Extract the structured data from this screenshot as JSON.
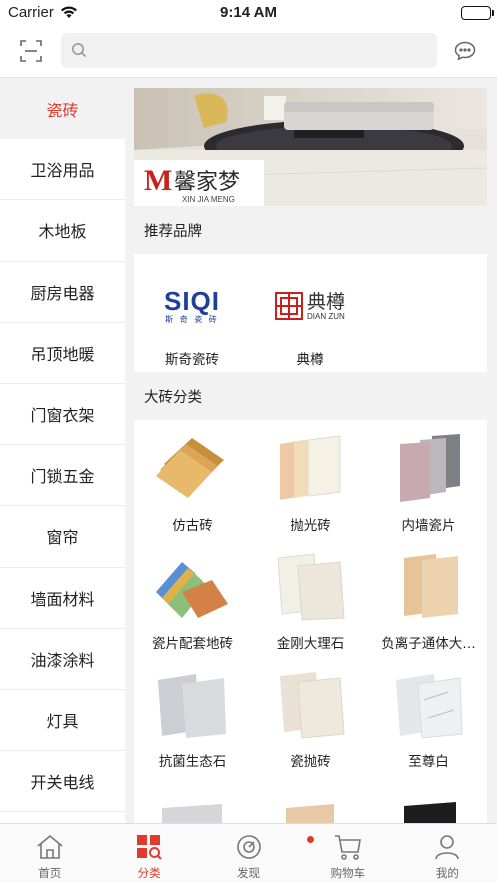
{
  "status_bar": {
    "carrier": "Carrier",
    "time": "9:14 AM"
  },
  "search": {
    "placeholder": ""
  },
  "sidebar": {
    "items": [
      {
        "label": "瓷砖",
        "active": true
      },
      {
        "label": "卫浴用品"
      },
      {
        "label": "木地板"
      },
      {
        "label": "厨房电器"
      },
      {
        "label": "吊顶地暖"
      },
      {
        "label": "门窗衣架"
      },
      {
        "label": "门锁五金"
      },
      {
        "label": "窗帘"
      },
      {
        "label": "墙面材料"
      },
      {
        "label": "油漆涂料"
      },
      {
        "label": "灯具"
      },
      {
        "label": "开关电线"
      }
    ]
  },
  "banner": {
    "logo_main": "馨家梦",
    "logo_sub": "XIN JIA MENG",
    "logo_mark": "M"
  },
  "brands_section": {
    "title": "推荐品牌",
    "brands": [
      {
        "name": "斯奇瓷砖",
        "logo_text": "SIQI",
        "logo_sub": "斯 奇 瓷 砖"
      },
      {
        "name": "典樽",
        "logo_text": "典樽",
        "logo_sub": "DIAN ZUN"
      }
    ]
  },
  "categories_section": {
    "title": "大砖分类",
    "items": [
      {
        "label": "仿古砖"
      },
      {
        "label": "抛光砖"
      },
      {
        "label": "内墙瓷片"
      },
      {
        "label": "瓷片配套地砖"
      },
      {
        "label": "金刚大理石"
      },
      {
        "label": "负离子通体大…"
      },
      {
        "label": "抗菌生态石"
      },
      {
        "label": "瓷抛砖"
      },
      {
        "label": "至尊白"
      }
    ]
  },
  "tab_bar": {
    "tabs": [
      {
        "label": "首页",
        "icon": "home-icon"
      },
      {
        "label": "分类",
        "icon": "category-icon",
        "active": true
      },
      {
        "label": "发现",
        "icon": "discover-icon",
        "badge": true
      },
      {
        "label": "购物车",
        "icon": "cart-icon"
      },
      {
        "label": "我的",
        "icon": "profile-icon"
      }
    ]
  },
  "colors": {
    "accent": "#e23a2e",
    "background": "#f2f2f2"
  }
}
